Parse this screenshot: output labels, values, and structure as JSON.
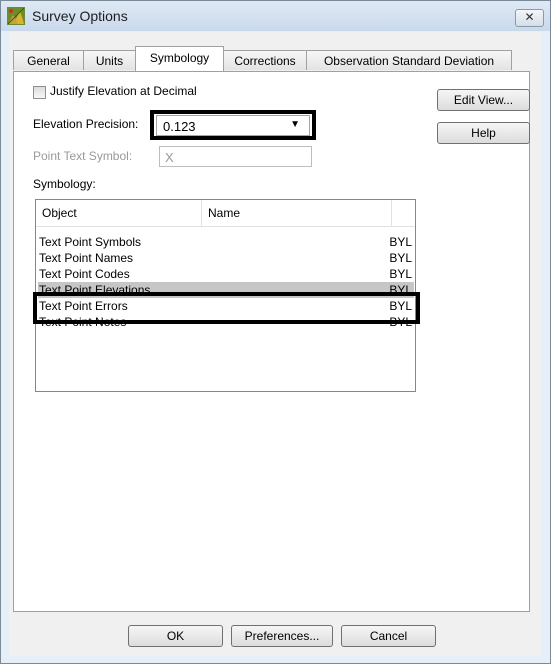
{
  "window": {
    "title": "Survey Options",
    "close_label": "✕"
  },
  "tabs": [
    {
      "label": "General",
      "active": false
    },
    {
      "label": "Units",
      "active": false
    },
    {
      "label": "Symbology",
      "active": true
    },
    {
      "label": "Corrections",
      "active": false
    },
    {
      "label": "Observation Standard Deviation",
      "active": false
    }
  ],
  "symbology": {
    "justify_label": "Justify Elevation at Decimal",
    "justify_checked": false,
    "precision_label": "Elevation Precision:",
    "precision_value": "0.123",
    "point_text_label": "Point Text Symbol:",
    "point_text_value": "X",
    "list_label": "Symbology:",
    "columns": [
      "Object",
      "Name"
    ],
    "rows": [
      {
        "object": "Text Point Symbols",
        "value": "BYL"
      },
      {
        "object": "Text Point Names",
        "value": "BYL"
      },
      {
        "object": "Text Point Codes",
        "value": "BYL"
      },
      {
        "object": "Text Point Elevations",
        "value": "BYL",
        "selected": true
      },
      {
        "object": "Text Point Errors",
        "value": "BYL"
      },
      {
        "object": "Text Point Notes",
        "value": "BYL"
      }
    ],
    "edit_view_label": "Edit View...",
    "help_label": "Help"
  },
  "footer": {
    "ok_label": "OK",
    "preferences_label": "Preferences...",
    "cancel_label": "Cancel"
  },
  "colors": {
    "highlight_outline": "#000000",
    "selected_row": "#c6c6c6",
    "window_frame": "#e6eef8"
  }
}
